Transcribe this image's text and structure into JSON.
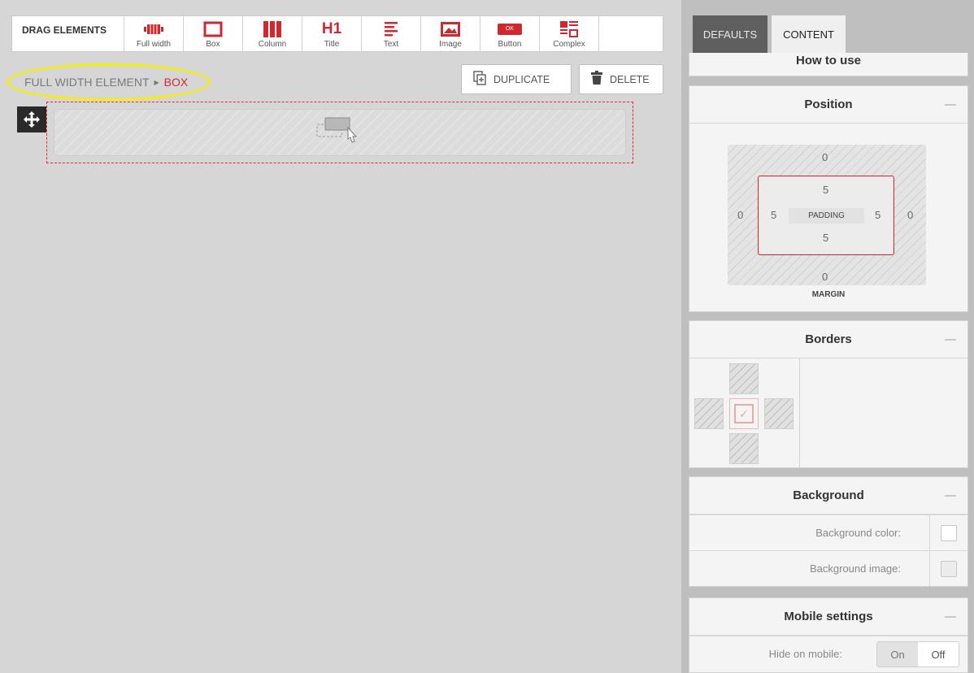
{
  "toolbar": {
    "label": "DRAG ELEMENTS",
    "items": [
      {
        "label": "Full width",
        "icon": "full-width-icon"
      },
      {
        "label": "Box",
        "icon": "box-icon"
      },
      {
        "label": "Column",
        "icon": "column-icon"
      },
      {
        "label": "Title",
        "icon": "title-h1-icon",
        "glyph": "H1"
      },
      {
        "label": "Text",
        "icon": "text-icon"
      },
      {
        "label": "Image",
        "icon": "image-icon"
      },
      {
        "label": "Button",
        "icon": "button-icon",
        "glyph": "OK"
      },
      {
        "label": "Complex",
        "icon": "complex-icon"
      }
    ]
  },
  "breadcrumb": {
    "parent": "FULL WIDTH ELEMENT",
    "current": "BOX"
  },
  "actions": {
    "duplicate": "DUPLICATE",
    "delete": "DELETE"
  },
  "tabs": {
    "defaults": "DEFAULTS",
    "content": "CONTENT",
    "active": "content"
  },
  "sections": {
    "how_to_use": {
      "title": "How to use"
    },
    "position": {
      "title": "Position",
      "margin": {
        "top": "0",
        "right": "0",
        "bottom": "0",
        "left": "0",
        "label": "MARGIN"
      },
      "padding": {
        "top": "5",
        "right": "5",
        "bottom": "5",
        "left": "5",
        "label": "PADDING"
      }
    },
    "borders": {
      "title": "Borders"
    },
    "background": {
      "title": "Background",
      "color_label": "Background color:",
      "image_label": "Background image:"
    },
    "mobile": {
      "title": "Mobile settings",
      "hide_label": "Hide on mobile:",
      "on": "On",
      "off": "Off",
      "selected": "Off"
    }
  },
  "colors": {
    "accent": "#d0282f",
    "panel_bg": "#bfbfbf",
    "canvas_bg": "#d6d6d6",
    "highlight": "#f4ee12"
  }
}
